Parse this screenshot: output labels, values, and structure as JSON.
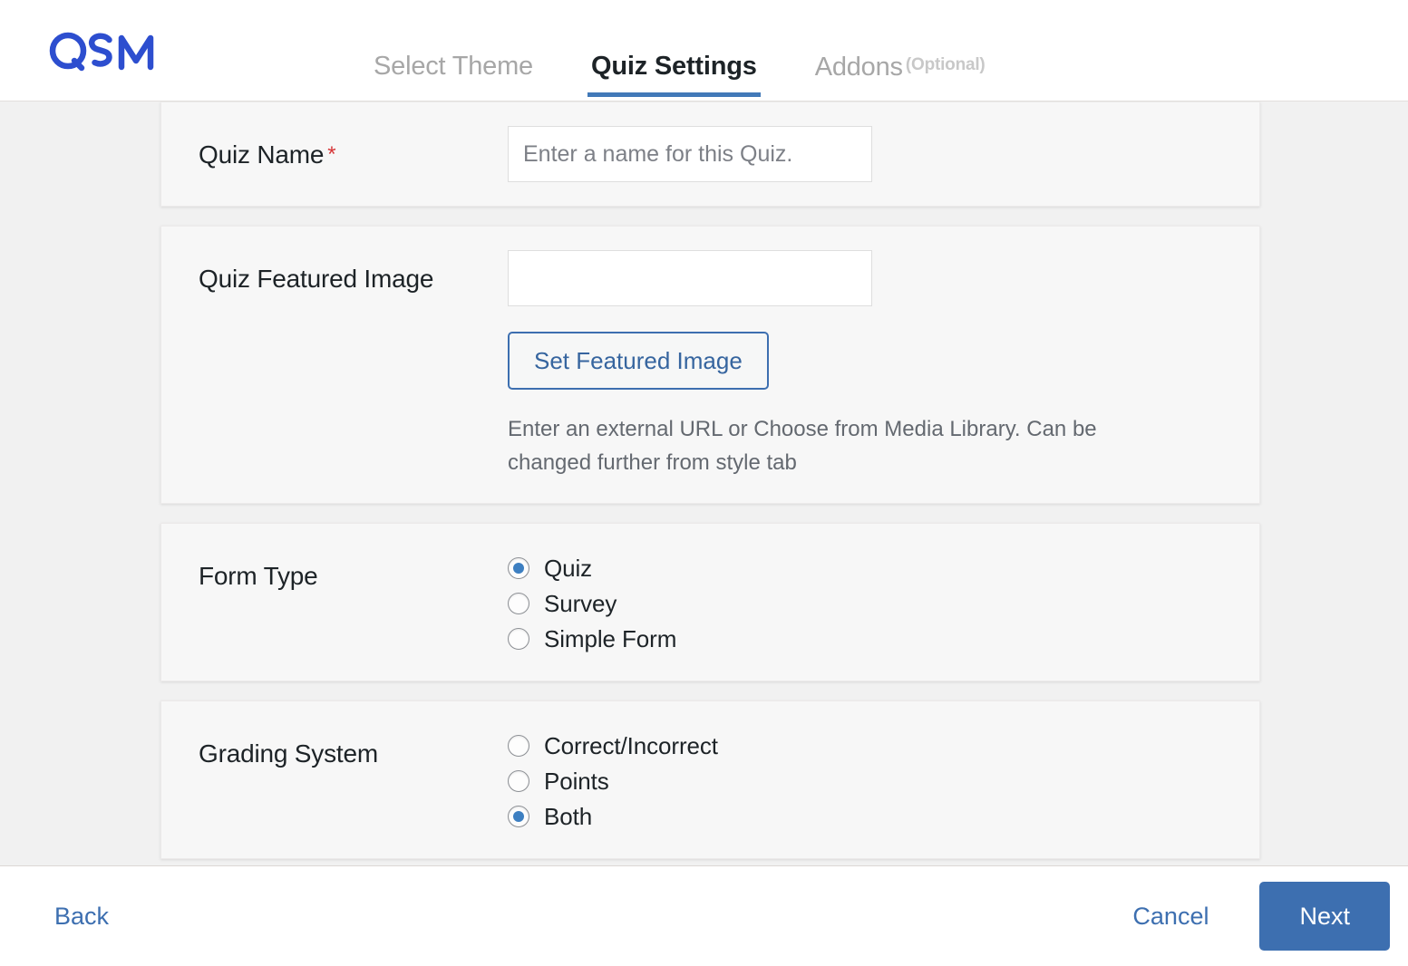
{
  "brand": {
    "logo_text": "QSM",
    "logo_color": "#2d4ecf"
  },
  "tabs": [
    {
      "label": "Select Theme",
      "active": false
    },
    {
      "label": "Quiz Settings",
      "active": true
    },
    {
      "label": "Addons",
      "suffix": "(Optional)",
      "active": false
    }
  ],
  "fields": {
    "quiz_name": {
      "label": "Quiz Name",
      "required_marker": "*",
      "placeholder": "Enter a name for this Quiz.",
      "value": ""
    },
    "featured_image": {
      "label": "Quiz Featured Image",
      "placeholder": "",
      "value": "",
      "button_label": "Set Featured Image",
      "helper_text": "Enter an external URL or Choose from Media Library. Can be changed further from style tab"
    },
    "form_type": {
      "label": "Form Type",
      "options": [
        {
          "label": "Quiz",
          "selected": true
        },
        {
          "label": "Survey",
          "selected": false
        },
        {
          "label": "Simple Form",
          "selected": false
        }
      ]
    },
    "grading_system": {
      "label": "Grading System",
      "options": [
        {
          "label": "Correct/Incorrect",
          "selected": false
        },
        {
          "label": "Points",
          "selected": false
        },
        {
          "label": "Both",
          "selected": true
        }
      ]
    }
  },
  "footer": {
    "back_label": "Back",
    "cancel_label": "Cancel",
    "next_label": "Next",
    "primary_color": "#3d6fb0"
  }
}
